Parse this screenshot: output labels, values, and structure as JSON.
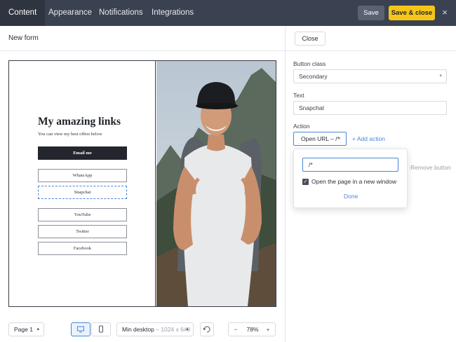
{
  "topbar": {
    "tabs": [
      "Content",
      "Appearance",
      "Notifications",
      "Integrations"
    ],
    "save": "Save",
    "save_close": "Save & close",
    "close_icon": "×"
  },
  "form": {
    "name": "New form"
  },
  "preview": {
    "headline": "My amazing links",
    "subheading": "You can view my best offers below",
    "email_button": "Email me",
    "links": [
      "WhatsApp",
      "Snapchat",
      "YouTube",
      "Twitter",
      "Facebook"
    ],
    "photo_icon": "person-photo"
  },
  "panel": {
    "close": "Close",
    "button_class_label": "Button class",
    "button_class_value": "Secondary",
    "text_label": "Text",
    "text_value": "Snapchat",
    "action_label": "Action",
    "action_chip": "Open URL – /*",
    "add_action": "+ Add action",
    "remove_button": "Remove button",
    "url_value": "/*",
    "open_new_window_label": "Open the page in a new window",
    "open_new_window_checked": true,
    "done": "Done"
  },
  "bottombar": {
    "page": "Page 1",
    "size_label": "Min desktop",
    "size_value": "– 1024 x 640",
    "zoom": "78%",
    "zoom_minus": "−",
    "zoom_plus": "+"
  },
  "colors": {
    "topbar": "#3a4150",
    "accent": "#f5c518",
    "link": "#4a86d6",
    "dark_button": "#23272d"
  }
}
